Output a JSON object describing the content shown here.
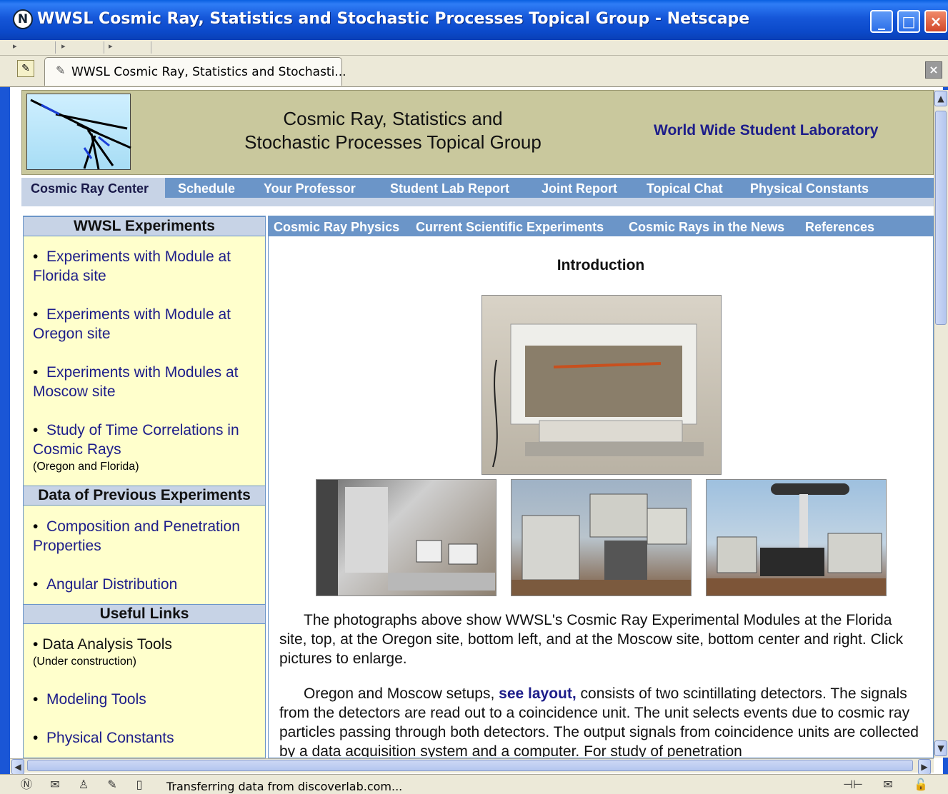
{
  "window": {
    "title": "WWSL Cosmic Ray, Statistics and Stochastic Processes Topical Group - Netscape",
    "tab_label": "WWSL Cosmic Ray, Statistics and Stochasti..."
  },
  "header": {
    "title_line1": "Cosmic Ray, Statistics and",
    "title_line2": "Stochastic Processes Topical Group",
    "subtitle": "World Wide Student Laboratory"
  },
  "main_nav": [
    "Cosmic Ray Center",
    "Schedule",
    "Your Professor",
    "Student Lab Report",
    "Joint Report",
    "Topical Chat",
    "Physical Constants"
  ],
  "sidebar": {
    "experiments_heading": "WWSL Experiments",
    "experiments": [
      "Experiments with Module at Florida site",
      "Experiments with Module at Oregon site",
      "Experiments with Modules at Moscow site",
      "Study of Time Correlations in Cosmic Rays"
    ],
    "experiments_note": "(Oregon and Florida)",
    "previous_heading": "Data of Previous Experiments",
    "previous": [
      "Composition and Penetration Properties",
      "Angular Distribution"
    ],
    "links_heading": "Useful Links",
    "links": [
      "Data Analysis Tools",
      "Modeling Tools",
      "Physical Constants"
    ],
    "links_note": "(Under construction)"
  },
  "sub_nav": [
    "Cosmic Ray Physics",
    "Current Scientific Experiments",
    "Cosmic Rays in the News",
    "References"
  ],
  "content": {
    "heading": "Introduction",
    "para1": "The photographs above show WWSL's Cosmic Ray Experimental Modules at the Florida site, top, at the Oregon site, bottom left, and at the Moscow site, bottom center and right. Click pictures to enlarge.",
    "para2_before": "Oregon and Moscow setups, ",
    "para2_link": "see layout,",
    "para2_after": " consists of two scintillating detectors. The signals from the detectors are read out to a coincidence unit. The unit selects events due to cosmic ray particles passing through both detectors. The output signals from coincidence units are collected by a data acquisition system and a computer. For study of penetration"
  },
  "status": {
    "text": "Transferring data from discoverlab.com..."
  }
}
